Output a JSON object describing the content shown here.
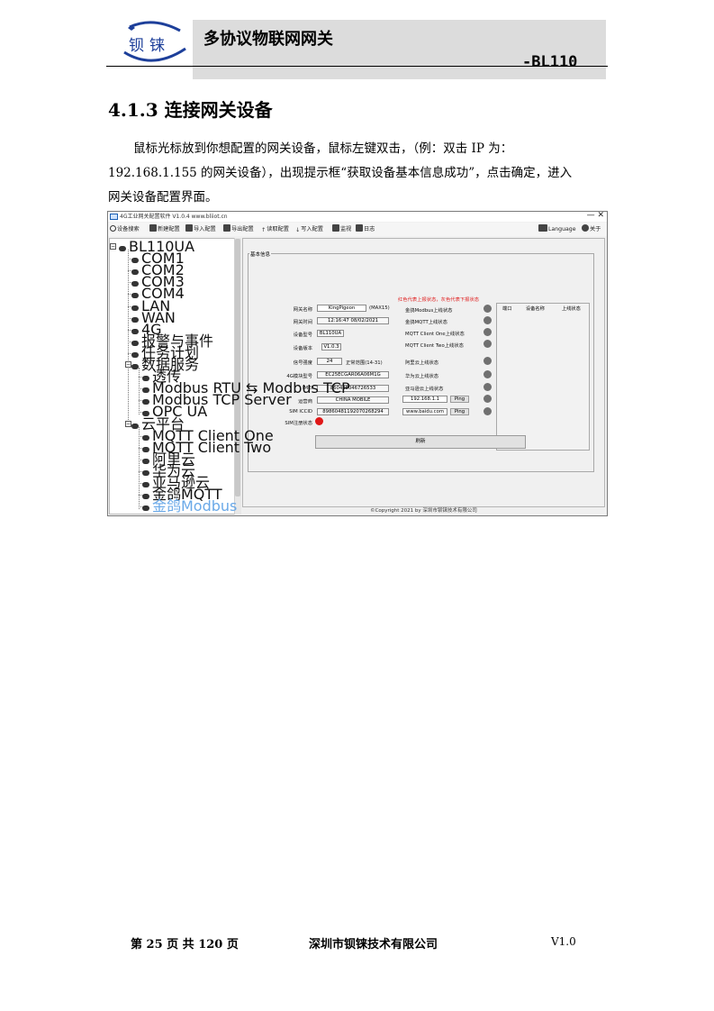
{
  "header": {
    "logo_text": "钡铼",
    "title": "多协议物联网网关",
    "model": "-BL110"
  },
  "section_title": "4.1.3 连接网关设备",
  "paragraph_lines": [
    "鼠标光标放到你想配置的网关设备，鼠标左键双击，（例：双击 IP 为：",
    "192.168.1.155 的网关设备），出现提示框“获取设备基本信息成功”，点击确定，进入",
    "网关设备配置界面。"
  ],
  "screenshot": {
    "window_title": "4G工业网关配置软件 V1.0.4 www.bliiot.cn",
    "window_controls": "— ✕",
    "toolbar": [
      "设备搜索",
      "新建配置",
      "导入配置",
      "导出配置",
      "读取配置",
      "写入配置",
      "监视",
      "日志"
    ],
    "toolbar_right": [
      "Language",
      "关于"
    ],
    "tree": [
      "BL110UA",
      "COM1",
      "COM2",
      "COM3",
      "COM4",
      "LAN",
      "WAN",
      "4G",
      "报警与事件",
      "任务计划",
      "数据服务",
      "透传",
      "Modbus RTU ⇆ Modbus TCP",
      "Modbus TCP Server",
      "OPC UA",
      "云平台",
      "MQTT Client One",
      "MQTT Client Two",
      "阿里云",
      "华为云",
      "亚马逊云",
      "金鸽MQTT",
      "金鸽Modbus"
    ],
    "group_title": "基本信息",
    "status_note": "红色代表上报状态，灰色代表下报状态",
    "fields": {
      "gateway_name_label": "网关名称",
      "gateway_name": "KingPigeon",
      "gateway_name_hint": "(MAX15)",
      "gateway_time_label": "网关时间",
      "gateway_time": "12:16:47 08/02/2021",
      "device_model_label": "设备型号",
      "device_model": "BL110UA",
      "device_version_label": "设备版本",
      "device_version": "V1.0.3",
      "signal_label": "信号强度",
      "signal": "24",
      "signal_hint": "正常范围(14-31)",
      "module_label": "4G模块型号",
      "module": "EC25ECGAR06A06M1G",
      "imei_label": "IMEI",
      "imei": "860425046726533",
      "operator_label": "运营商",
      "operator": "CHINA MOBILE",
      "iccid_label": "SIM ICCID",
      "iccid": "89860481192070268294",
      "sim_status_label": "SIM注册状态"
    },
    "cloud_status": [
      "金鸽Modbus上线状态",
      "金鸽MQTT上线状态",
      "MQTT Client One上线状态",
      "MQTT Client Two上线状态",
      "阿里云上线状态",
      "华为云上线状态",
      "亚马逊云上线状态"
    ],
    "ping_targets": [
      "192.168.1.1",
      "www.baidu.com"
    ],
    "ping_label": "Ping",
    "side_headers": [
      "端口",
      "设备名称",
      "上线状态"
    ],
    "refresh_label": "刷新",
    "copyright": "©Copyright 2021 by 深圳市钡铼技术有限公司",
    "colors": {
      "online": "#e01818",
      "offline": "#707070"
    }
  },
  "footer": {
    "page_info": "第 25 页 共 120 页",
    "company": "深圳市钡铼技术有限公司",
    "version": "V1.0"
  }
}
